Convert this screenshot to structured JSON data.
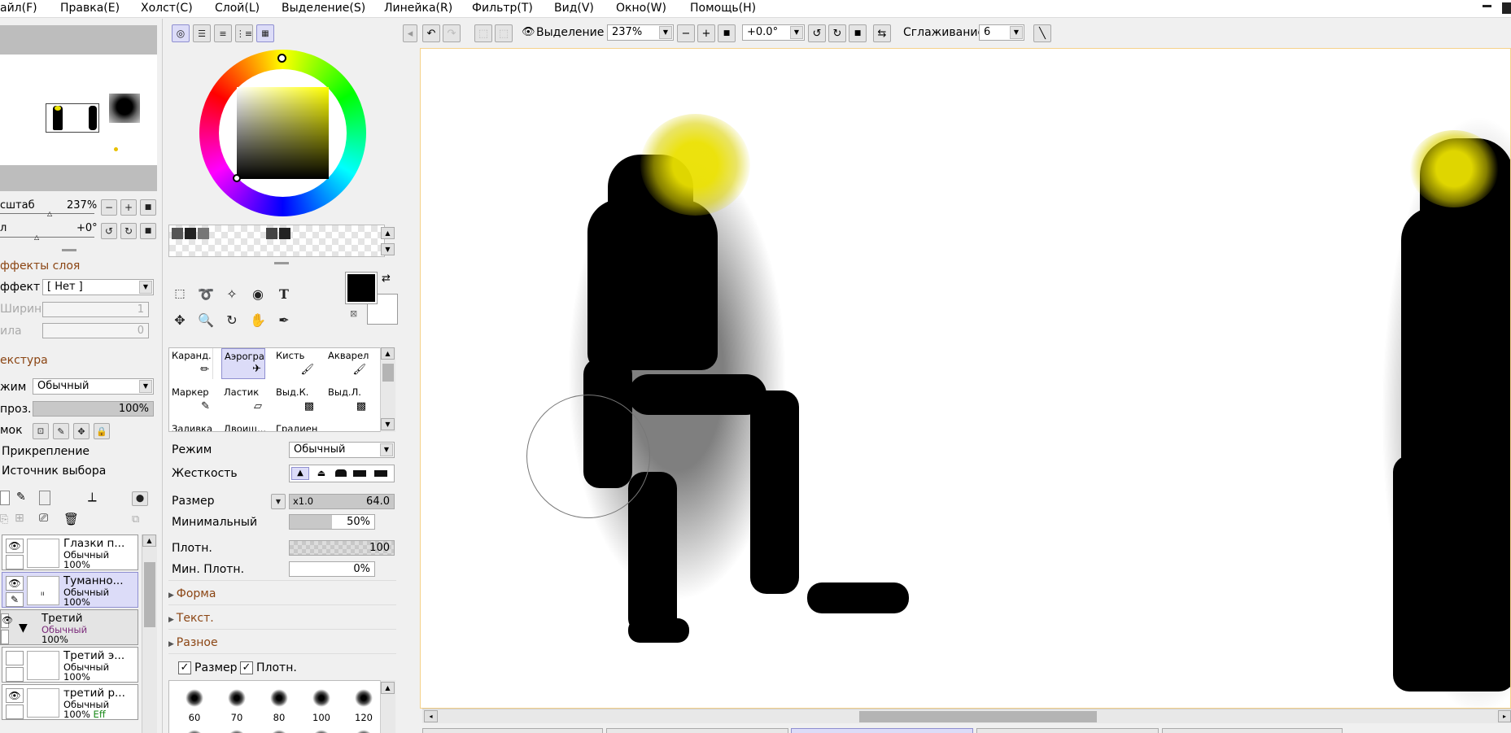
{
  "menu": [
    "айл(F)",
    "Правка(E)",
    "Холст(C)",
    "Слой(L)",
    "Выделение(S)",
    "Линейка(R)",
    "Фильтр(T)",
    "Вид(V)",
    "Окно(W)",
    "Помощь(H)"
  ],
  "navigator": {
    "scale_label": "сштаб",
    "scale_value": "237%",
    "angle_label": "л",
    "angle_value": "+0°"
  },
  "layer_effects": {
    "title": "ффекты слоя",
    "effect_label": "ффект",
    "effect_value": "[ Нет ]",
    "width_label": "Ширина",
    "width_value": "1",
    "strength_label": "ила",
    "strength_value": "0"
  },
  "texture": {
    "title": "екстура",
    "mode_label": "жим",
    "mode_value": "Обычный",
    "opacity_label": "проз.",
    "opacity_value": "100%",
    "lock_label": "мок",
    "attach_label": "Прикрепление",
    "source_label": "Источник выбора"
  },
  "layers": [
    {
      "name": "Глазки п...",
      "mode": "Обычный",
      "opacity": "100%",
      "visible": true,
      "selected": false
    },
    {
      "name": "Туманно...",
      "mode": "Обычный",
      "opacity": "100%",
      "visible": true,
      "selected": true
    },
    {
      "name": "Третий",
      "mode": "Обычный",
      "opacity": "100%",
      "visible": true,
      "folder": true
    },
    {
      "name": "Третий э...",
      "mode": "Обычный",
      "opacity": "100%",
      "visible": false,
      "selected": false
    },
    {
      "name": "третий р...",
      "mode": "Обычный",
      "opacity": "100%",
      "visible": true,
      "selected": false,
      "badge": "Eff"
    }
  ],
  "tools": {
    "brushes": [
      {
        "name": "Каранд.",
        "icon": "pencil-icon"
      },
      {
        "name": "Аэрограф",
        "icon": "airbrush-icon",
        "selected": true
      },
      {
        "name": "Кисть",
        "icon": "brush-icon"
      },
      {
        "name": "Акварель",
        "icon": "watercolor-icon"
      },
      {
        "name": "Маркер",
        "icon": "marker-icon"
      },
      {
        "name": "Ластик",
        "icon": "eraser-icon"
      },
      {
        "name": "Выд.К.",
        "icon": "select-pen-icon"
      },
      {
        "name": "Выд.Л.",
        "icon": "select-eraser-icon"
      },
      {
        "name": "Заливка",
        "icon": "fill-icon"
      },
      {
        "name": "Двоищ...",
        "icon": "binary-icon"
      },
      {
        "name": "Градиент",
        "icon": "gradient-icon"
      }
    ],
    "text_tool": "T"
  },
  "brush_settings": {
    "mode_label": "Режим",
    "mode_value": "Обычный",
    "hardness_label": "Жесткость",
    "size_label": "Размер",
    "size_multiplier": "x1.0",
    "size_value": "64.0",
    "min_size_label": "Минимальный",
    "min_size_value": "50%",
    "min_size_fraction": 0.5,
    "density_label": "Плотн.",
    "density_value": "100",
    "min_density_label": "Мин. Плотн.",
    "min_density_value": "0%",
    "section_shape": "Форма",
    "section_texture": "Текст.",
    "section_misc": "Разное",
    "chk_size": "Размер",
    "chk_density": "Плотн.",
    "preset_sizes": [
      "60",
      "70",
      "80",
      "100",
      "120"
    ]
  },
  "canvas_toolbar": {
    "selection_label": "Выделение",
    "zoom_value": "237%",
    "rotate_value": "+0.0°",
    "smoothing_label": "Сглаживание",
    "smoothing_value": "6"
  },
  "colors": {
    "primary": "#000000",
    "secondary": "#ffffff",
    "hue": "#ffff00",
    "accent": "#f5d28a",
    "section": "#8b4513"
  }
}
